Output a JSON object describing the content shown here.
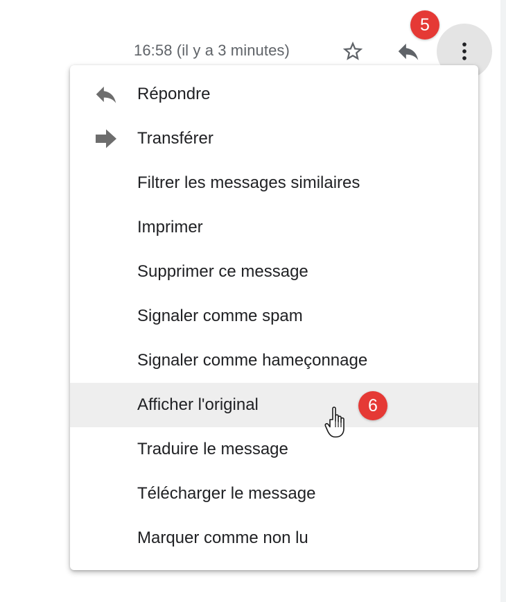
{
  "header": {
    "timestamp": "16:58 (il y a 3 minutes)",
    "star_icon": "star-outline-icon",
    "reply_icon": "reply-icon",
    "more_icon": "more-vertical-icon"
  },
  "badges": {
    "step5": "5",
    "step6": "6",
    "color": "#e53935"
  },
  "menu": {
    "items": [
      {
        "label": "Répondre",
        "icon": "reply-icon"
      },
      {
        "label": "Transférer",
        "icon": "forward-icon"
      },
      {
        "label": "Filtrer les messages similaires"
      },
      {
        "label": "Imprimer"
      },
      {
        "label": "Supprimer ce message"
      },
      {
        "label": "Signaler comme spam"
      },
      {
        "label": "Signaler comme hameçonnage"
      },
      {
        "label": "Afficher l'original",
        "highlighted": true
      },
      {
        "label": "Traduire le message"
      },
      {
        "label": "Télécharger le message"
      },
      {
        "label": "Marquer comme non lu"
      }
    ]
  },
  "colors": {
    "hover_bg": "#eeeeee",
    "text": "#202124",
    "secondary_text": "#5f6368",
    "icon": "#6d6d6d"
  }
}
